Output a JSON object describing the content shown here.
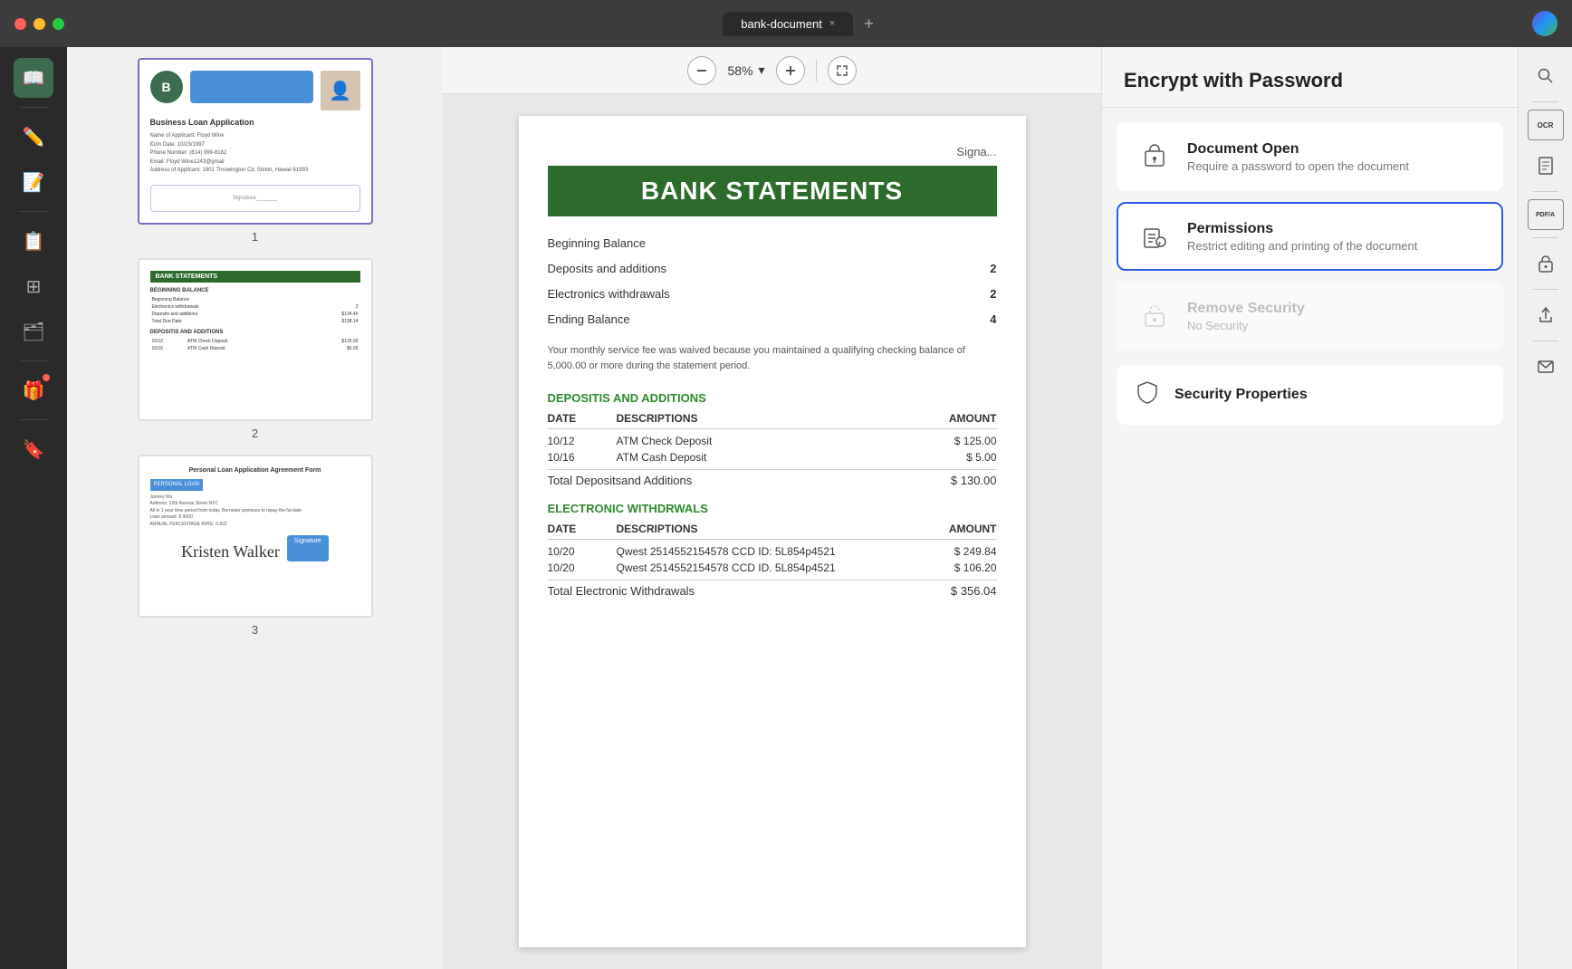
{
  "titlebar": {
    "tab_title": "bank-document",
    "tab_close": "×",
    "tab_new": "+"
  },
  "toolbar": {
    "zoom_level": "58%",
    "zoom_dropdown": "▾"
  },
  "left_sidebar": {
    "icons": [
      {
        "name": "reader-icon",
        "symbol": "📖",
        "active": true
      },
      {
        "name": "highlight-icon",
        "symbol": "✏️",
        "active": false
      },
      {
        "name": "annotate-icon",
        "symbol": "📝",
        "active": false
      },
      {
        "name": "pages-icon",
        "symbol": "📋",
        "active": false
      },
      {
        "name": "compare-icon",
        "symbol": "⊞",
        "active": false
      },
      {
        "name": "layers-icon",
        "symbol": "🗂",
        "active": false
      },
      {
        "name": "gift-icon",
        "symbol": "🎁",
        "active": false,
        "has_badge": true
      },
      {
        "name": "bookmark-icon",
        "symbol": "🔖",
        "active": false
      }
    ]
  },
  "thumbnails": [
    {
      "page_num": "1",
      "selected": true,
      "title": "Business Loan Application"
    },
    {
      "page_num": "2",
      "selected": false,
      "title": "BANK STATEMENTS"
    },
    {
      "page_num": "3",
      "selected": false,
      "title": "Personal Loan Application Agreement Form"
    }
  ],
  "pdf_content": {
    "banner": "BANK STATEMENTS",
    "signature_label": "Signa...",
    "rows": [
      {
        "label": "Beginning Balance",
        "instalment": "",
        "value": ""
      },
      {
        "label": "Deposits and additions",
        "instalment": "2",
        "value": ""
      },
      {
        "label": "Electronics withdrawals",
        "instalment": "2",
        "value": ""
      },
      {
        "label": "Ending Balance",
        "instalment": "4",
        "value": ""
      }
    ],
    "note": "Your monthly service fee was waived because you maintained a qualifying checking balance of 5,000.00 or more during the statement period.",
    "deposits_section": "DEPOSITIS AND ADDITIONS",
    "deposits_headers": [
      "DATE",
      "DESCRIPTIONS",
      "AMOUNT"
    ],
    "deposits_rows": [
      {
        "date": "10/12",
        "desc": "ATM Check Deposit",
        "amount": "$ 125.00"
      },
      {
        "date": "10/16",
        "desc": "ATM Cash Deposit",
        "amount": "$ 5.00"
      }
    ],
    "deposits_total_label": "Total Depositsand Additions",
    "deposits_total": "$ 130.00",
    "electronics_section": "ELECTRONIC WITHDRWALS",
    "electronics_headers": [
      "DATE",
      "DESCRIPTIONS",
      "AMOUNT"
    ],
    "electronics_rows": [
      {
        "date": "10/20",
        "desc": "Qwest 2514552154578 CCD ID: 5L854p4521",
        "amount": "$ 249.84"
      },
      {
        "date": "10/20",
        "desc": "Qwest 2514552154578 CCD ID. 5L854p4521",
        "amount": "$ 106.20"
      }
    ],
    "electronics_total_label": "Total Electronic Withdrawals",
    "electronics_total": "$ 356.04"
  },
  "encrypt_panel": {
    "title": "Encrypt with Password",
    "options": [
      {
        "id": "document-open",
        "title": "Document Open",
        "description": "Require a password to open the document",
        "icon": "🔐",
        "selected": false,
        "disabled": false
      },
      {
        "id": "permissions",
        "title": "Permissions",
        "description": "Restrict editing and printing of the document",
        "icon": "📄",
        "selected": true,
        "disabled": false
      },
      {
        "id": "remove-security",
        "title": "Remove Security",
        "description": "No Security",
        "icon": "🔓",
        "selected": false,
        "disabled": true
      }
    ],
    "security_properties": {
      "title": "Security Properties",
      "icon": "🛡"
    }
  },
  "far_right_sidebar": {
    "icons": [
      {
        "name": "search-icon",
        "symbol": "🔍"
      },
      {
        "name": "ocr-icon",
        "label": "OCR"
      },
      {
        "name": "scan-icon",
        "symbol": "📄"
      },
      {
        "name": "pdfa-icon",
        "label": "PDF/A"
      },
      {
        "name": "lock-icon",
        "symbol": "🔒"
      },
      {
        "name": "share-icon",
        "symbol": "⬆"
      },
      {
        "name": "mail-icon",
        "symbol": "✉"
      }
    ]
  }
}
